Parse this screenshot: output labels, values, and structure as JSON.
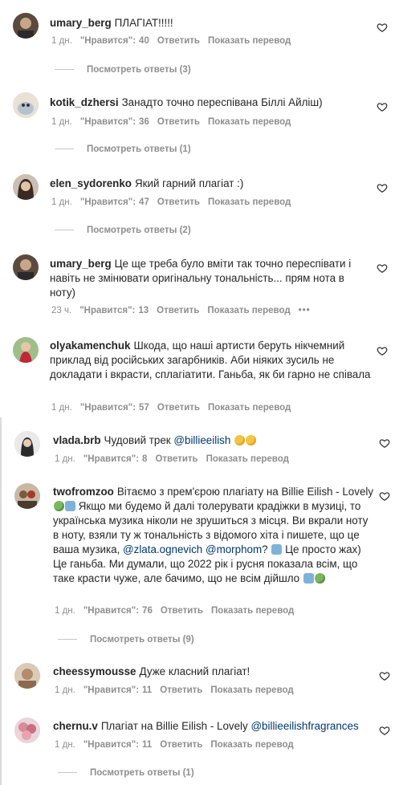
{
  "labels": {
    "likes_prefix": "\"Нравится\":",
    "reply": "Ответить",
    "translate": "Показать перевод",
    "more": "•••"
  },
  "comments": [
    {
      "username": "umary_berg",
      "text": "ПЛАГІАТ!!!!!",
      "time": "1 дн.",
      "likes": "40",
      "replies_label": "Посмотреть ответы (3)"
    },
    {
      "username": "kotik_dzhersi",
      "text": "Занадто точно переспівана Біллі Айліш)",
      "time": "1 дн.",
      "likes": "36",
      "replies_label": "Посмотреть ответы (1)"
    },
    {
      "username": "elen_sydorenko",
      "text": "Який гарний плагіат :)",
      "time": "1 дн.",
      "likes": "47",
      "replies_label": "Посмотреть ответы (2)"
    },
    {
      "username": "umary_berg",
      "text": "Це ще треба було вміти так точно переспівати і навіть не змінювати оригінальну тональність... прям нота в ноту)",
      "time": "23 ч.",
      "likes": "13"
    },
    {
      "username": "olyakamenchuk",
      "text": "Шкода, що наші артисти беруть нікчемний приклад від російських загарбників. Аби ніяких зусиль не докладати і вкрасти, сплагіатити. Ганьба, як би гарно не співала",
      "time": "1 дн.",
      "likes": "57"
    },
    {
      "username": "vlada.brb",
      "text": "Чудовий трек",
      "mention": "@billieeilish",
      "time": "1 дн.",
      "likes": "8"
    },
    {
      "username": "twofromzoo",
      "text_a": "Вітаємо з прем'єрою плагіату на Billie Eilish - Lovely",
      "text_b": "Якщо ми будемо й далі толерувати крадіжки в музиці, то українська музика ніколи не зрушиться з місця. Ви вкрали ноту в ноту, взяли ту ж тональність з відомого хіта і пишете, що це ваша музика,",
      "mention_a": "@zlata.ognevich",
      "mention_b": "@morphom",
      "text_c": "?",
      "text_d": "Це просто жах) Це ганьба. Ми думали, що 2022 рік і русня показала всім, що таке красти чуже, але бачимо, що не всім дійшло",
      "time": "1 дн.",
      "likes": "76",
      "replies_label": "Посмотреть ответы (9)"
    },
    {
      "username": "cheessymousse",
      "text": "Дуже класний плагіат!",
      "time": "1 дн.",
      "likes": "11"
    },
    {
      "username": "chernu.v",
      "text": "Плагіат на Billie Eilish - Lovely",
      "mention": "@billieeilishfragrances",
      "time": "1 дн.",
      "likes": "11",
      "replies_label": "Посмотреть ответы (1)"
    }
  ],
  "colors": {
    "text": "#262626",
    "meta": "#8e8e8e",
    "mention": "#00376b"
  }
}
